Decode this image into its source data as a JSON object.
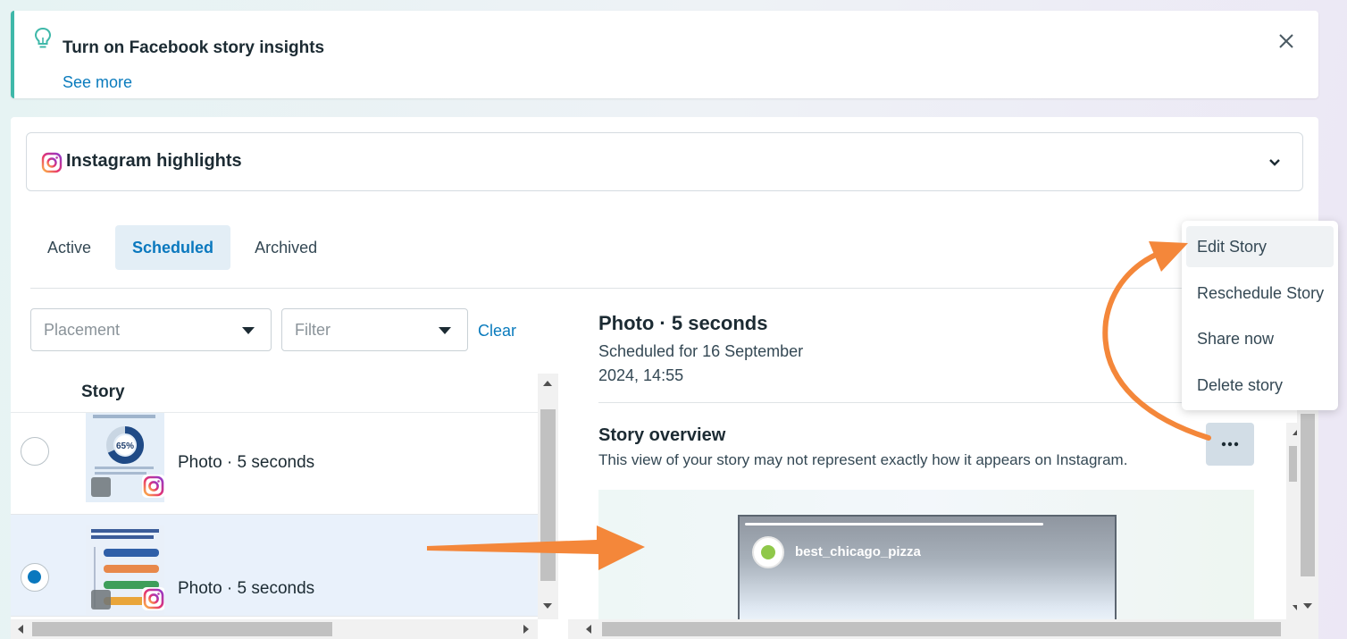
{
  "banner": {
    "title": "Turn on Facebook story insights",
    "see_more": "See more"
  },
  "highlights": {
    "label": "Instagram highlights"
  },
  "tabs": [
    {
      "label": "Active",
      "active": false
    },
    {
      "label": "Scheduled",
      "active": true
    },
    {
      "label": "Archived",
      "active": false
    }
  ],
  "filters": {
    "placement_placeholder": "Placement",
    "filter_placeholder": "Filter",
    "clear_label": "Clear"
  },
  "list": {
    "column_header": "Story",
    "rows": [
      {
        "label": "Photo · 5 seconds",
        "selected": false
      },
      {
        "label": "Photo · 5 seconds",
        "selected": true
      }
    ]
  },
  "detail": {
    "title": "Photo · 5 seconds",
    "scheduled": "Scheduled for 16 September 2024, 14:55",
    "overview_title": "Story overview",
    "overview_desc": "This view of your story may not represent exactly how it appears on Instagram.",
    "preview_handle": "best_chicago_pizza"
  },
  "menu": {
    "items": [
      {
        "label": "Edit Story"
      },
      {
        "label": "Reschedule Story"
      },
      {
        "label": "Share now"
      },
      {
        "label": "Delete story"
      }
    ]
  },
  "colors": {
    "accent": "#0a78be",
    "banner_border": "#3fb8a9",
    "annotation_arrow": "#f4873a"
  }
}
